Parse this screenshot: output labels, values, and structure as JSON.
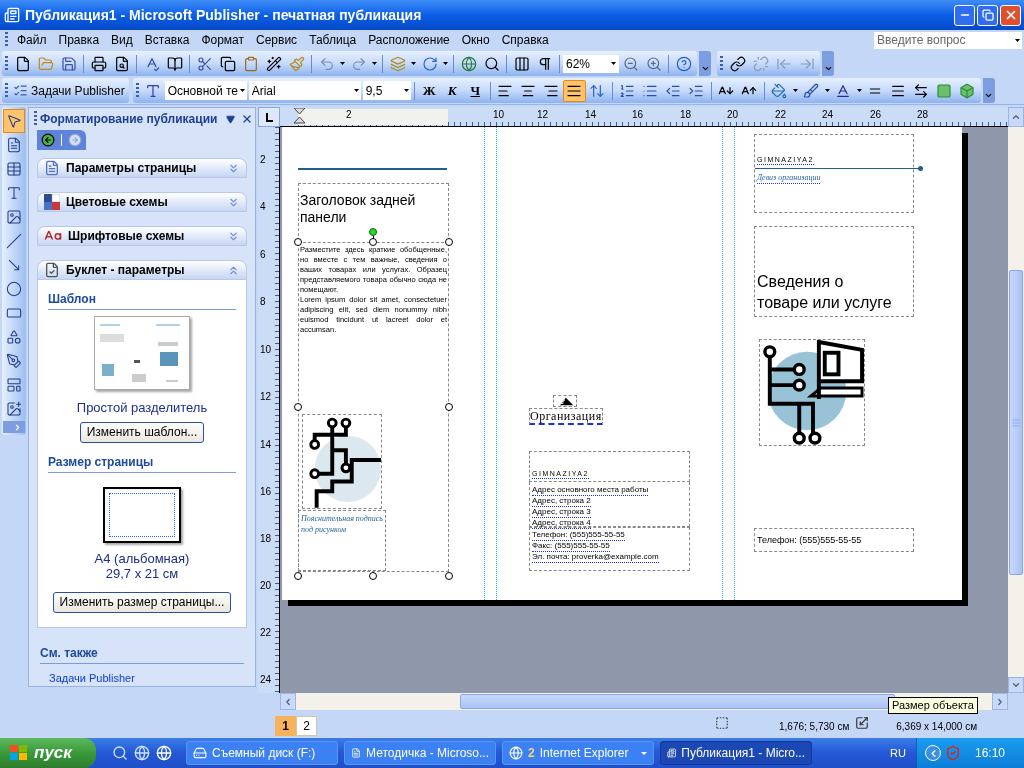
{
  "window": {
    "title": "Публикация1 - Microsoft Publisher - печатная публикация"
  },
  "menu": [
    "Файл",
    "Правка",
    "Вид",
    "Вставка",
    "Формат",
    "Сервис",
    "Таблица",
    "Расположение",
    "Окно",
    "Справка"
  ],
  "help_box": {
    "placeholder": "Введите вопрос"
  },
  "standard_toolbar": {
    "zoom": "62%"
  },
  "formatting_toolbar": {
    "tasks_button": "Задачи Publisher",
    "style": "Основной те",
    "font": "Arial",
    "size": "9,5",
    "bold": "Ж",
    "italic": "К",
    "underline": "Ч",
    "alignment": [
      {
        "kind": "left",
        "selected": false
      },
      {
        "kind": "center",
        "selected": false
      },
      {
        "kind": "right",
        "selected": false
      },
      {
        "kind": "justify",
        "selected": true
      }
    ]
  },
  "tools": [
    {
      "kind": "pointer",
      "selected": true
    },
    {
      "kind": "text_box",
      "selected": false
    },
    {
      "kind": "table",
      "selected": false
    },
    {
      "kind": "wordart",
      "selected": false
    },
    {
      "kind": "picture",
      "selected": false
    },
    {
      "kind": "line",
      "selected": false
    },
    {
      "kind": "arrow",
      "selected": false
    },
    {
      "kind": "oval",
      "selected": false
    },
    {
      "kind": "rectangle",
      "selected": false
    },
    {
      "kind": "autoshapes",
      "selected": false
    },
    {
      "kind": "hotspot",
      "selected": false
    },
    {
      "kind": "design_gallery",
      "selected": false
    },
    {
      "kind": "add_picture",
      "selected": false
    }
  ],
  "task_pane": {
    "title": "Форматирование публикации",
    "sections": [
      {
        "kind": "page",
        "title": "Параметры страницы",
        "expanded": false
      },
      {
        "kind": "color",
        "title": "Цветовые схемы",
        "expanded": false
      },
      {
        "kind": "font",
        "title": "Шрифтовые схемы",
        "expanded": false
      },
      {
        "kind": "booklet",
        "title": "Буклет - параметры",
        "expanded": true,
        "template_heading": "Шаблон",
        "template_name": "Простой разделитель",
        "change_template": "Изменить шаблон...",
        "size_heading": "Размер страницы",
        "size_name": "A4 (альбомная)",
        "size_dims": "29,7 x 21 см",
        "change_size": "Изменить размер страницы..."
      }
    ],
    "see_also": {
      "heading": "См. также",
      "links": [
        "Задачи Publisher"
      ]
    }
  },
  "rulers": {
    "horizontal": [
      "2",
      "10",
      "12",
      "14",
      "16",
      "18",
      "20",
      "22",
      "24",
      "26",
      "28"
    ],
    "vertical": [
      "2",
      "4",
      "6",
      "8",
      "10",
      "12",
      "14",
      "16",
      "18",
      "20",
      "22",
      "24"
    ]
  },
  "publication": {
    "left_panel": {
      "heading": "Заголовок задней панели",
      "body": [
        "Разместите здесь краткие обобщенные, но вместе с тем важные, сведения о ваших товарах или услугах. Образец представляемого товара обычно сюда не помещают.",
        "Lorem ipsum dolor sit amet, consectetuer adipiscing elit, sed diem nonummy nibh euismod tincidunt ut lacreet dolor et accumsan."
      ],
      "caption": "Пояснительная подпись под рисунком"
    },
    "middle_panel": {
      "organization": "Организация",
      "name": "GIMNAZIYA2",
      "address": [
        "Адрес основного места работы",
        "Адрес, строка 2",
        "Адрес, строка 3",
        "Адрес, строка 4"
      ],
      "contacts": [
        "Телефон: (555)555-55-55",
        "Факс: (555)555-55-55",
        "Эл. почта: proverka@example.com"
      ]
    },
    "right_panel": {
      "name": "GIMNAZIYA2",
      "motto": "Девиз организации",
      "title": "Сведения о товаре или услуге",
      "phone": "Телефон: (555)555-55-55"
    }
  },
  "page_tabs": [
    {
      "label": "1",
      "selected": true
    },
    {
      "label": "2",
      "selected": false
    }
  ],
  "status_bar": {
    "position": "1,676; 5,730 см",
    "size": "6,369 x 14,000 см"
  },
  "tooltip": "Размер объекта",
  "taskbar": {
    "start": "пуск",
    "tasks": [
      {
        "kind": "drive",
        "label": "Съемный диск (F:)",
        "selected": false
      },
      {
        "kind": "word",
        "label": "Методичка - Microso...",
        "selected": false
      },
      {
        "kind": "browser",
        "count": "2",
        "label": "Internet Explorer",
        "selected": false
      },
      {
        "kind": "publisher",
        "label": "Публикация1 - Micro...",
        "selected": true
      }
    ],
    "language": "RU",
    "clock": "16:10"
  }
}
